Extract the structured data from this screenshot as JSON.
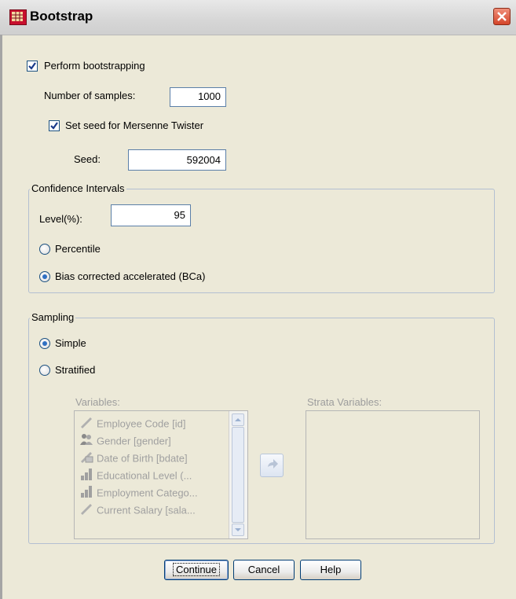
{
  "window": {
    "title": "Bootstrap",
    "close_icon": "close-icon"
  },
  "bootstrap": {
    "perform_label": "Perform bootstrapping",
    "perform_checked": true,
    "samples_label": "Number of samples:",
    "samples_value": "1000",
    "seed_check_label": "Set seed for Mersenne Twister",
    "seed_checked": true,
    "seed_label": "Seed:",
    "seed_value": "592004"
  },
  "confidence": {
    "group_title": "Confidence Intervals",
    "level_label": "Level(%):",
    "level_value": "95",
    "options": [
      {
        "label": "Percentile",
        "selected": false
      },
      {
        "label": "Bias corrected accelerated (BCa)",
        "selected": true
      }
    ]
  },
  "sampling": {
    "group_title": "Sampling",
    "options": [
      {
        "label": "Simple",
        "selected": true
      },
      {
        "label": "Stratified",
        "selected": false
      }
    ],
    "variables_label": "Variables:",
    "strata_label": "Strata Variables:",
    "variables": [
      {
        "label": "Employee Code [id]",
        "icon": "scale-ruler-icon"
      },
      {
        "label": "Gender [gender]",
        "icon": "nominal-people-icon"
      },
      {
        "label": "Date of Birth [bdate]",
        "icon": "date-scale-icon"
      },
      {
        "label": "Educational Level (...",
        "icon": "ordinal-bars-icon"
      },
      {
        "label": "Employment Catego...",
        "icon": "ordinal-bars-icon"
      },
      {
        "label": "Current Salary [sala...",
        "icon": "scale-ruler-icon"
      }
    ],
    "move_icon": "arrow-right-icon"
  },
  "buttons": {
    "continue": "Continue",
    "cancel": "Cancel",
    "help": "Help"
  },
  "colors": {
    "dialog_bg": "#ece9d8",
    "accent": "#1c5180",
    "disabled_text": "#9d9d9d"
  }
}
